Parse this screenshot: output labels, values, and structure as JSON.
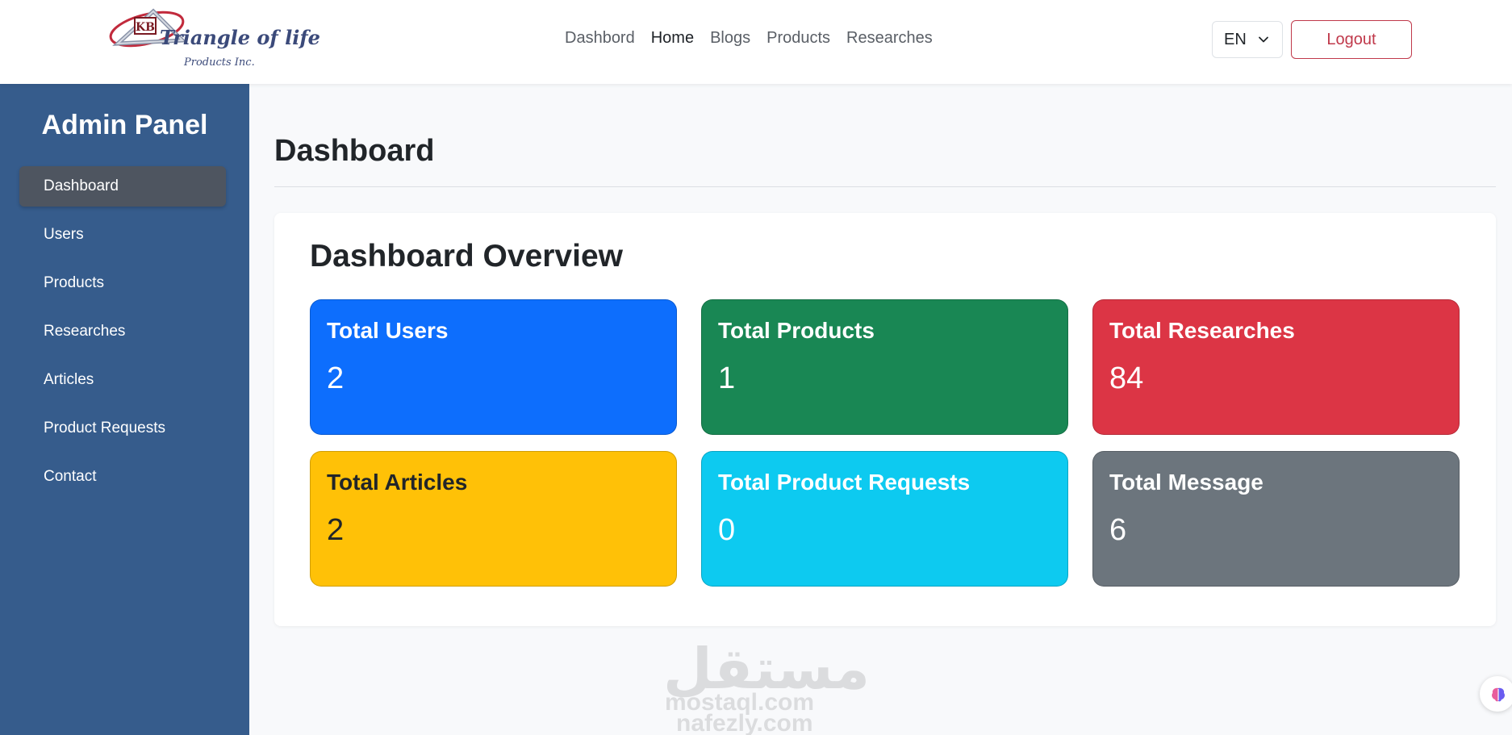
{
  "header": {
    "logo": {
      "mark": "KB",
      "name": "Triangle of life",
      "subtitle": "Products Inc."
    },
    "nav": [
      "Dashbord",
      "Home",
      "Blogs",
      "Products",
      "Researches"
    ],
    "active_nav": "Home",
    "language": "EN",
    "logout_label": "Logout"
  },
  "sidebar": {
    "title": "Admin Panel",
    "items": [
      "Dashboard",
      "Users",
      "Products",
      "Researches",
      "Articles",
      "Product Requests",
      "Contact"
    ],
    "active_item": "Dashboard"
  },
  "main": {
    "page_title": "Dashboard",
    "overview_title": "Dashboard Overview",
    "stats": [
      {
        "label": "Total Users",
        "value": "2",
        "color": "#0d6efd",
        "text_color": "#ffffff"
      },
      {
        "label": "Total Products",
        "value": "1",
        "color": "#198754",
        "text_color": "#ffffff"
      },
      {
        "label": "Total Researches",
        "value": "84",
        "color": "#dc3545",
        "text_color": "#ffffff"
      },
      {
        "label": "Total Articles",
        "value": "2",
        "color": "#ffc107",
        "text_color": "#212529"
      },
      {
        "label": "Total Product Requests",
        "value": "0",
        "color": "#0dcaf0",
        "text_color": "#ffffff"
      },
      {
        "label": "Total Message",
        "value": "6",
        "color": "#6c757d",
        "text_color": "#ffffff"
      }
    ]
  },
  "watermark": {
    "arabic": "مستقل",
    "line1": "mostaql.com",
    "line2": "nafezly.com"
  },
  "colors": {
    "sidebar_bg": "#365c8c",
    "sidebar_active": "#4e5560",
    "logout_border": "#c0394b"
  }
}
